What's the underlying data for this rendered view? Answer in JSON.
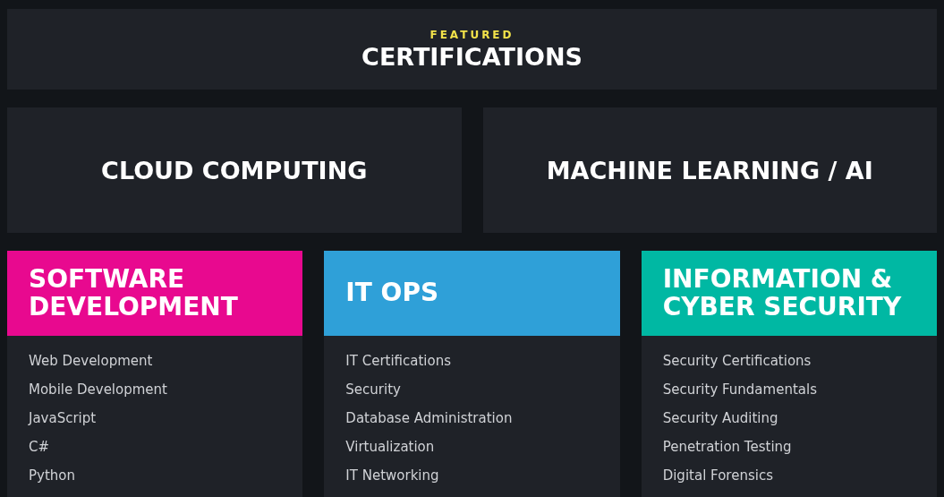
{
  "banner": {
    "eyebrow": "FEATURED",
    "title": "CERTIFICATIONS"
  },
  "featured": [
    {
      "title": "CLOUD COMPUTING"
    },
    {
      "title": "MACHINE LEARNING / AI"
    }
  ],
  "categories": [
    {
      "title": "SOFTWARE DEVELOPMENT",
      "color": "#e8098f",
      "links": [
        "Web Development",
        "Mobile Development",
        "JavaScript",
        "C#",
        "Python"
      ]
    },
    {
      "title": "IT OPS",
      "color": "#2fa0d8",
      "links": [
        "IT Certifications",
        "Security",
        "Database Administration",
        "Virtualization",
        "IT Networking"
      ]
    },
    {
      "title": "INFORMATION & CYBER SECURITY",
      "color": "#00b8a3",
      "links": [
        "Security Certifications",
        "Security Fundamentals",
        "Security Auditing",
        "Penetration Testing",
        "Digital Forensics"
      ]
    }
  ]
}
